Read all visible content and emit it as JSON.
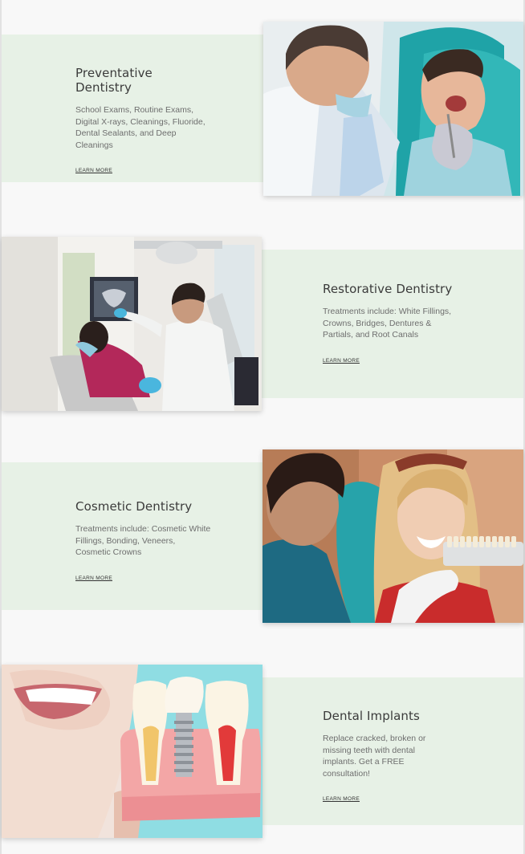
{
  "services": [
    {
      "title": "Preventative Dentistry",
      "description": "School Exams, Routine Exams, Digital X-rays, Cleanings, Fluoride, Dental Sealants, and Deep Cleanings",
      "link": "LEARN MORE"
    },
    {
      "title": "Restorative Dentistry",
      "description": "Treatments include: White Fillings, Crowns, Bridges, Dentures & Partials, and Root Canals",
      "link": "LEARN MORE"
    },
    {
      "title": "Cosmetic Dentistry",
      "description": "Treatments include:  Cosmetic White Fillings, Bonding, Veneers, Cosmetic Crowns",
      "link": "LEARN MORE"
    },
    {
      "title": "Dental Implants",
      "description": "Replace cracked, broken or missing teeth with dental implants.  Get a FREE consultation!",
      "link": "LEARN MORE"
    }
  ],
  "colors": {
    "page_background": "#f8f8f8",
    "panel_background": "#e7f1e6",
    "title_text": "#3b3b3b",
    "body_text": "#6e6e6e"
  }
}
